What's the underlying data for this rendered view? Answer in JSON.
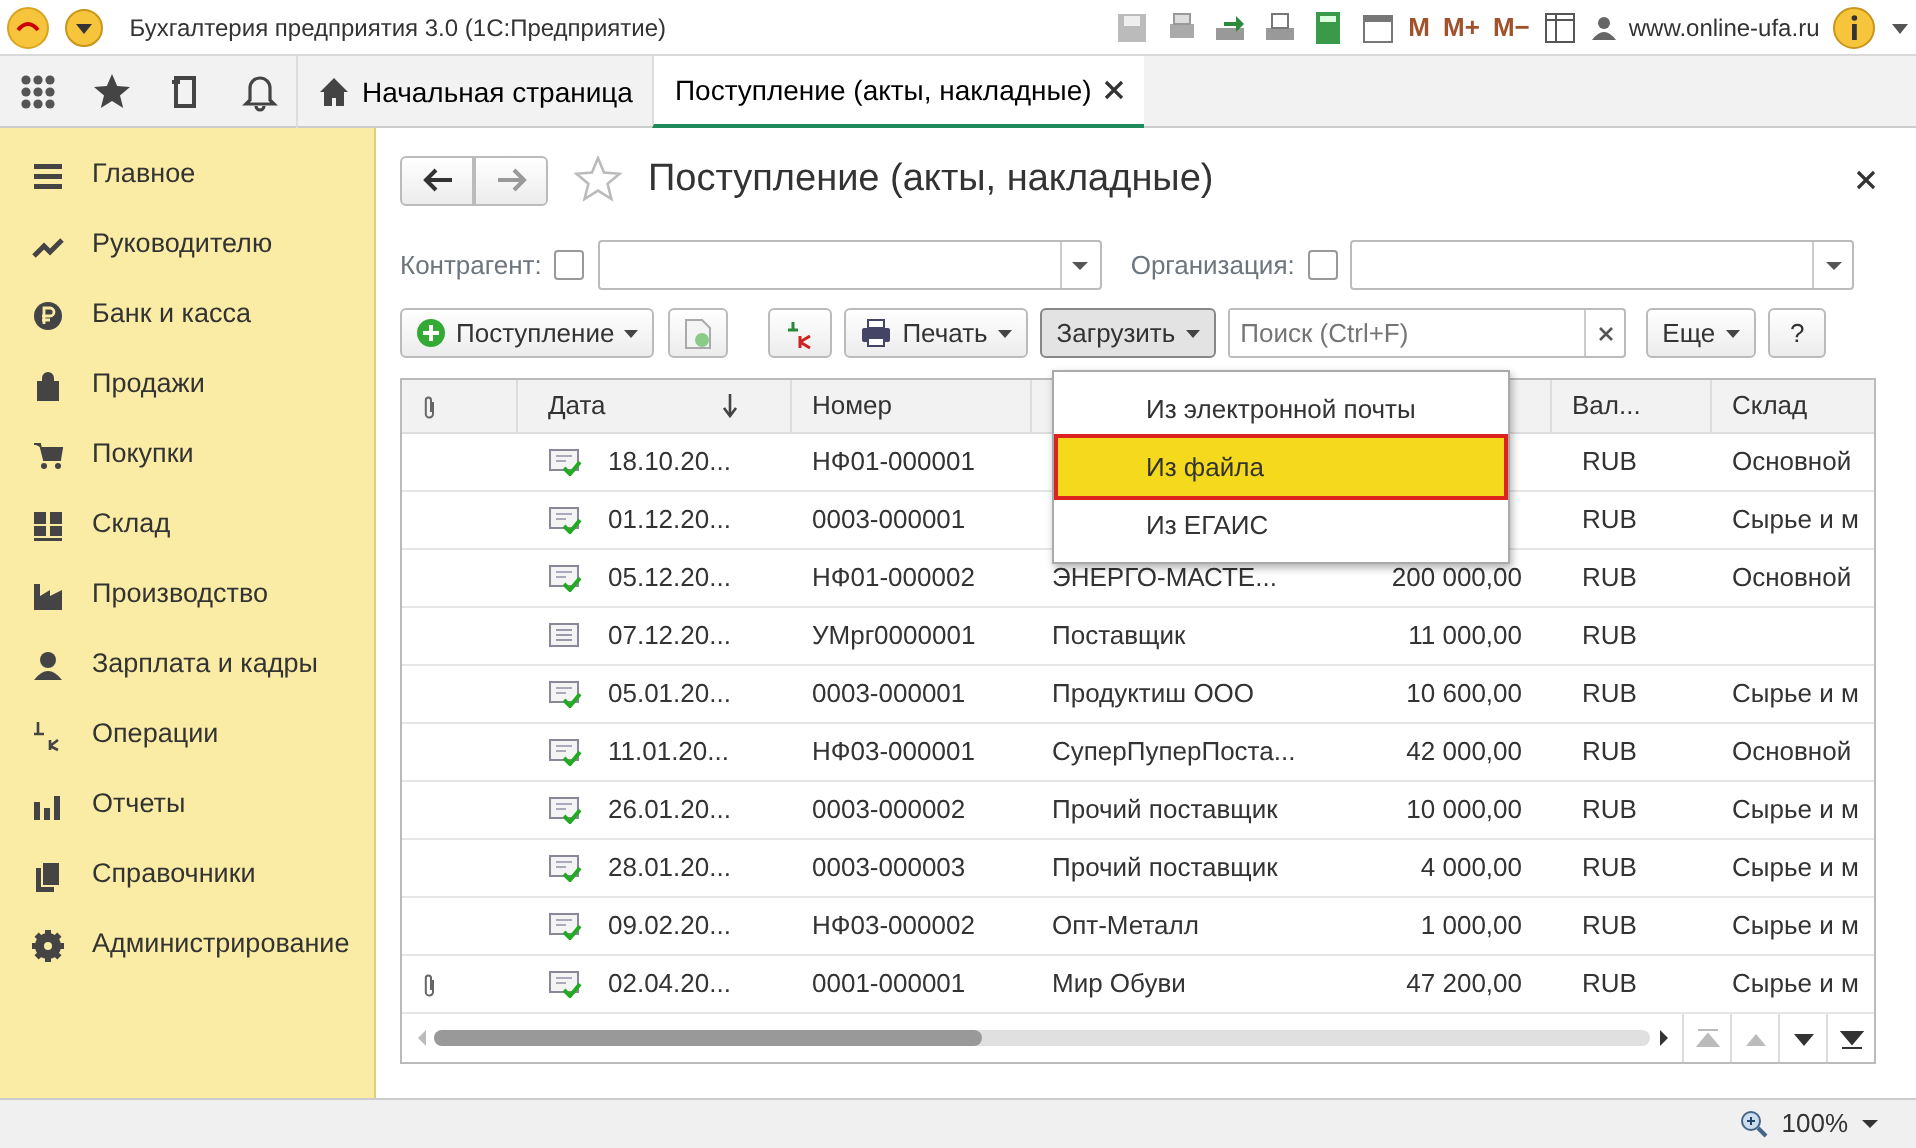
{
  "title_bar": {
    "title": "Бухгалтерия предприятия 3.0  (1С:Предприятие)",
    "memory_buttons": [
      "M",
      "M+",
      "M−"
    ],
    "user": "www.online-ufa.ru"
  },
  "tabs": [
    {
      "label": "Начальная страница",
      "selected": false,
      "kind": "home"
    },
    {
      "label": "Поступление (акты, накладные)",
      "selected": true,
      "kind": "doc"
    }
  ],
  "sidebar": {
    "items": [
      {
        "label": "Главное"
      },
      {
        "label": "Руководителю"
      },
      {
        "label": "Банк и касса"
      },
      {
        "label": "Продажи"
      },
      {
        "label": "Покупки"
      },
      {
        "label": "Склад"
      },
      {
        "label": "Производство"
      },
      {
        "label": "Зарплата и кадры"
      },
      {
        "label": "Операции"
      },
      {
        "label": "Отчеты"
      },
      {
        "label": "Справочники"
      },
      {
        "label": "Администрирование"
      }
    ]
  },
  "form": {
    "title": "Поступление (акты, накладные)",
    "filters": [
      {
        "label": "Контрагент:",
        "checked": false
      },
      {
        "label": "Организация:",
        "checked": false
      }
    ],
    "create_button": "Поступление",
    "print_button": "Печать",
    "load_button": "Загрузить",
    "search": {
      "placeholder": "Поиск (Ctrl+F)"
    },
    "more_button": "Еще",
    "help_button": "?",
    "load_menu": [
      {
        "label": "Из электронной почты",
        "selected": false
      },
      {
        "label": "Из файла",
        "selected": true
      },
      {
        "label": "Из ЕГАИС",
        "selected": false
      }
    ],
    "table": {
      "columns": [
        "Дата",
        "Номер",
        null,
        null,
        "Вал...",
        "Склад"
      ],
      "rows": [
        {
          "attached": false,
          "posted": true,
          "date": "18.10.20...",
          "number": "НФ01-000001",
          "counterparty": null,
          "sum": null,
          "currency": "RUB",
          "warehouse": "Основной"
        },
        {
          "attached": false,
          "posted": true,
          "date": "01.12.20...",
          "number": "0003-000001",
          "counterparty": null,
          "sum": null,
          "currency": "RUB",
          "warehouse": "Сырье и м"
        },
        {
          "attached": false,
          "posted": true,
          "date": "05.12.20...",
          "number": "НФ01-000002",
          "counterparty": "ЭНЕРГО-МАСТЕ...",
          "sum": "200 000,00",
          "currency": "RUB",
          "warehouse": "Основной"
        },
        {
          "attached": false,
          "posted": false,
          "date": "07.12.20...",
          "number": "УМрг0000001",
          "counterparty": "Поставщик",
          "sum": "11 000,00",
          "currency": "RUB",
          "warehouse": null
        },
        {
          "attached": false,
          "posted": true,
          "date": "05.01.20...",
          "number": "0003-000001",
          "counterparty": "Продуктиш ООО",
          "sum": "10 600,00",
          "currency": "RUB",
          "warehouse": "Сырье и м"
        },
        {
          "attached": false,
          "posted": true,
          "date": "11.01.20...",
          "number": "НФ03-000001",
          "counterparty": "СуперПуперПоста...",
          "sum": "42 000,00",
          "currency": "RUB",
          "warehouse": "Основной"
        },
        {
          "attached": false,
          "posted": true,
          "date": "26.01.20...",
          "number": "0003-000002",
          "counterparty": "Прочий поставщик",
          "sum": "10 000,00",
          "currency": "RUB",
          "warehouse": "Сырье и м"
        },
        {
          "attached": false,
          "posted": true,
          "date": "28.01.20...",
          "number": "0003-000003",
          "counterparty": "Прочий поставщик",
          "sum": "4 000,00",
          "currency": "RUB",
          "warehouse": "Сырье и м"
        },
        {
          "attached": false,
          "posted": true,
          "date": "09.02.20...",
          "number": "НФ03-000002",
          "counterparty": "Опт-Металл",
          "sum": "1 000,00",
          "currency": "RUB",
          "warehouse": "Сырье и м"
        },
        {
          "attached": true,
          "posted": true,
          "date": "02.04.20...",
          "number": "0001-000001",
          "counterparty": "Мир Обуви",
          "sum": "47 200,00",
          "currency": "RUB",
          "warehouse": "Сырье и м"
        }
      ]
    }
  },
  "status_bar": {
    "zoom": "100%"
  }
}
